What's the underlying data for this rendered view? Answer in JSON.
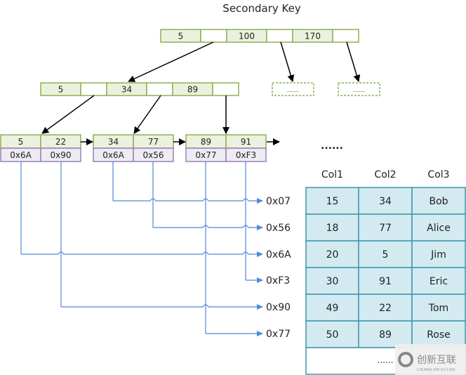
{
  "title": "Secondary Key",
  "colors": {
    "key_fill": "#ebf1de",
    "key_border": "#8cb055",
    "ptr_fill": "#ffffff",
    "leaf_addr_fill": "#eeebf3",
    "leaf_addr_border": "#9a7fba",
    "table_fill": "#d3eaf1",
    "table_border": "#3d96ae",
    "link_line": "#4d8ad6",
    "arrow": "#000000"
  },
  "root_node": {
    "keys": [
      "5",
      "100",
      "170"
    ]
  },
  "internal_node": {
    "keys": [
      "5",
      "34",
      "89"
    ]
  },
  "placeholder_nodes": [
    "......",
    "......"
  ],
  "leaf_nodes": [
    {
      "keys": [
        "5",
        "22"
      ],
      "addrs": [
        "0x6A",
        "0x90"
      ]
    },
    {
      "keys": [
        "34",
        "77"
      ],
      "addrs": [
        "0x6A",
        "0x56"
      ]
    },
    {
      "keys": [
        "89",
        "91"
      ],
      "addrs": [
        "0x77",
        "0xF3"
      ]
    }
  ],
  "leaf_ellipsis": "......",
  "row_addresses": [
    "0x07",
    "0x56",
    "0x6A",
    "0xF3",
    "0x90",
    "0x77"
  ],
  "table": {
    "headers": [
      "Col1",
      "Col2",
      "Col3"
    ],
    "rows": [
      [
        "15",
        "34",
        "Bob"
      ],
      [
        "18",
        "77",
        "Alice"
      ],
      [
        "20",
        "5",
        "Jim"
      ],
      [
        "30",
        "91",
        "Eric"
      ],
      [
        "49",
        "22",
        "Tom"
      ],
      [
        "50",
        "89",
        "Rose"
      ]
    ],
    "footer": "......"
  },
  "watermark": {
    "text": "创新互联",
    "subtext": "CHUANG XIN HU LIAN"
  }
}
